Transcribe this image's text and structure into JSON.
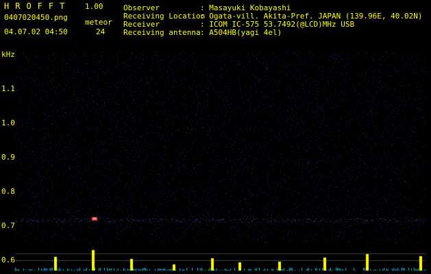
{
  "header": {
    "logo": "HROFFT",
    "version": "1.00",
    "filename": "0407020450.png",
    "datetime": "04.07.02 04:50",
    "meteor_label": "meteor",
    "meteor_count": "24",
    "info_labels": [
      "Observer",
      "Receiving Location",
      "Receiver",
      "Receiving antenna"
    ],
    "info_values": [
      ": Masayuki Kobayashi",
      ": Ogata-vill. Akita-Pref. JAPAN (139.96E, 40.02N)",
      ": ICOM IC-575 53.7492(@LCD)MHz USB",
      ": A504HB(yagi 4el)"
    ]
  },
  "plot": {
    "y_unit_label": "kHz",
    "y_ticks": [
      "1.1",
      "1.0",
      "0.9",
      "0.8",
      "0.7",
      "0.6"
    ],
    "time_ticks": [
      "0451",
      "0452",
      "0453",
      "0454",
      "0455",
      "0456",
      "0457",
      "0458",
      "0459",
      "0500"
    ],
    "colors": {
      "background": "#000000",
      "noise": "#1a1a66",
      "signal": "#ffff00",
      "graph_base": "#00d0ff",
      "hot": "#ff4040",
      "text": "#ffff00"
    }
  }
}
